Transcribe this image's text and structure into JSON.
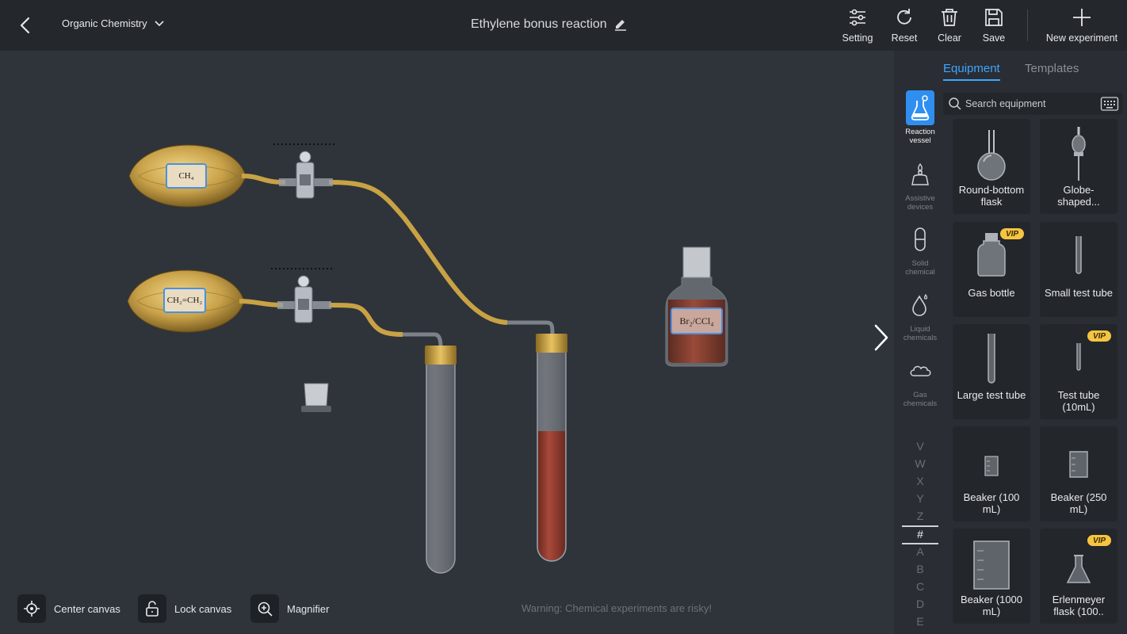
{
  "header": {
    "course": "Organic Chemistry",
    "title": "Ethylene bonus reaction",
    "tools": [
      {
        "label": "Setting",
        "icon": "sliders-icon"
      },
      {
        "label": "Reset",
        "icon": "refresh-icon"
      },
      {
        "label": "Clear",
        "icon": "trash-icon"
      },
      {
        "label": "Save",
        "icon": "save-icon"
      },
      {
        "label": "New experiment",
        "icon": "plus-icon"
      }
    ]
  },
  "canvas": {
    "bag_top_label": "CH₄",
    "bag_bottom_label": "CH₂=CH₂",
    "bottle_label": "Br₂/CCl₄",
    "warning": "Warning: Chemical experiments are risky!",
    "bottom_tools": [
      {
        "label": "Center canvas",
        "icon": "crosshair-icon"
      },
      {
        "label": "Lock canvas",
        "icon": "unlock-icon"
      },
      {
        "label": "Magnifier",
        "icon": "zoom-in-icon"
      }
    ]
  },
  "panel": {
    "tabs": [
      "Equipment",
      "Templates"
    ],
    "active_tab": "Equipment",
    "search_placeholder": "Search equipment",
    "categories": [
      {
        "label": "Reaction vessel",
        "icon": "flask-icon",
        "active": true
      },
      {
        "label": "Assistive devices",
        "icon": "burner-icon",
        "active": false
      },
      {
        "label": "Solid chemical",
        "icon": "capsule-icon",
        "active": false
      },
      {
        "label": "Liquid chemicals",
        "icon": "droplet-icon",
        "active": false
      },
      {
        "label": "Gas chemicals",
        "icon": "cloud-icon",
        "active": false
      }
    ],
    "alphabet": [
      "V",
      "W",
      "X",
      "Y",
      "Z",
      "#",
      "A",
      "B",
      "C",
      "D",
      "E"
    ],
    "alphabet_selected": "#",
    "items": [
      {
        "label": "Round-bottom flask",
        "vip": false
      },
      {
        "label": "Globe-shaped...",
        "vip": false
      },
      {
        "label": "Gas bottle",
        "vip": true
      },
      {
        "label": "Small test tube",
        "vip": false
      },
      {
        "label": "Large test tube",
        "vip": false
      },
      {
        "label": "Test tube (10mL)",
        "vip": true
      },
      {
        "label": "Beaker (100 mL)",
        "vip": false
      },
      {
        "label": "Beaker (250 mL)",
        "vip": false
      },
      {
        "label": "Beaker (1000 mL)",
        "vip": false
      },
      {
        "label": "Erlenmeyer flask (100..",
        "vip": true
      }
    ],
    "vip_badge": "VIP"
  },
  "colors": {
    "accent": "#3ea6ff",
    "vip": "#f5c542",
    "bromine_solution": "#8e3b2e",
    "gas_bag": "#c9a24a"
  }
}
